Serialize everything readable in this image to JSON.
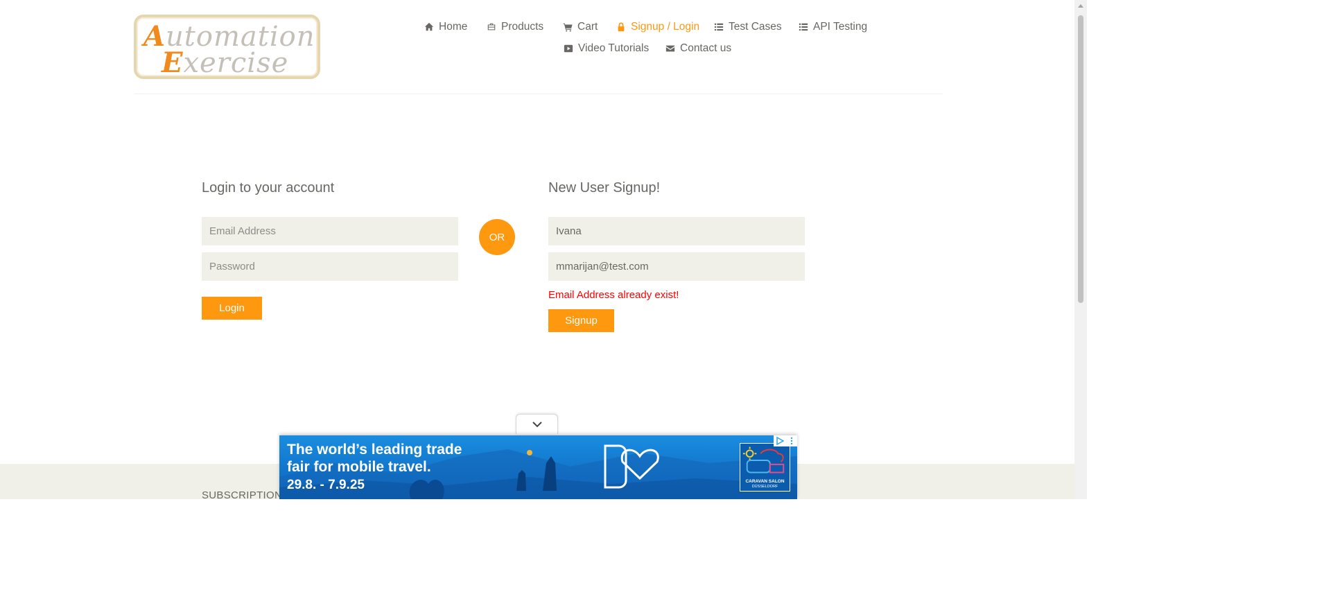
{
  "logo": {
    "line1_cap": "A",
    "line1_rest": "utomation",
    "line2_cap": "E",
    "line2_rest": "xercise"
  },
  "nav": {
    "home": "Home",
    "products": "Products",
    "cart": "Cart",
    "signup_login": "Signup / Login",
    "test_cases": "Test Cases",
    "api_testing": "API Testing",
    "video_tutorials": "Video Tutorials",
    "contact_us": "Contact us"
  },
  "login": {
    "title": "Login to your account",
    "email_placeholder": "Email Address",
    "password_placeholder": "Password",
    "button": "Login"
  },
  "or_label": "OR",
  "signup": {
    "title": "New User Signup!",
    "name_value": "Ivana",
    "email_value": "mmarijan@test.com",
    "error": "Email Address already exist!",
    "button": "Signup"
  },
  "footer": {
    "subscription": "SUBSCRIPTION"
  },
  "ad": {
    "headline_line1": "The world’s leading trade",
    "headline_line2": "fair for mobile travel.",
    "dates": "29.8. - 7.9.25",
    "brand_line1": "CARAVAN SALON",
    "brand_line2": "DÜSSELDORF"
  },
  "colors": {
    "accent": "#fe980f",
    "field_bg": "#f0f0e9",
    "error": "#ff0000",
    "text": "#696763"
  }
}
